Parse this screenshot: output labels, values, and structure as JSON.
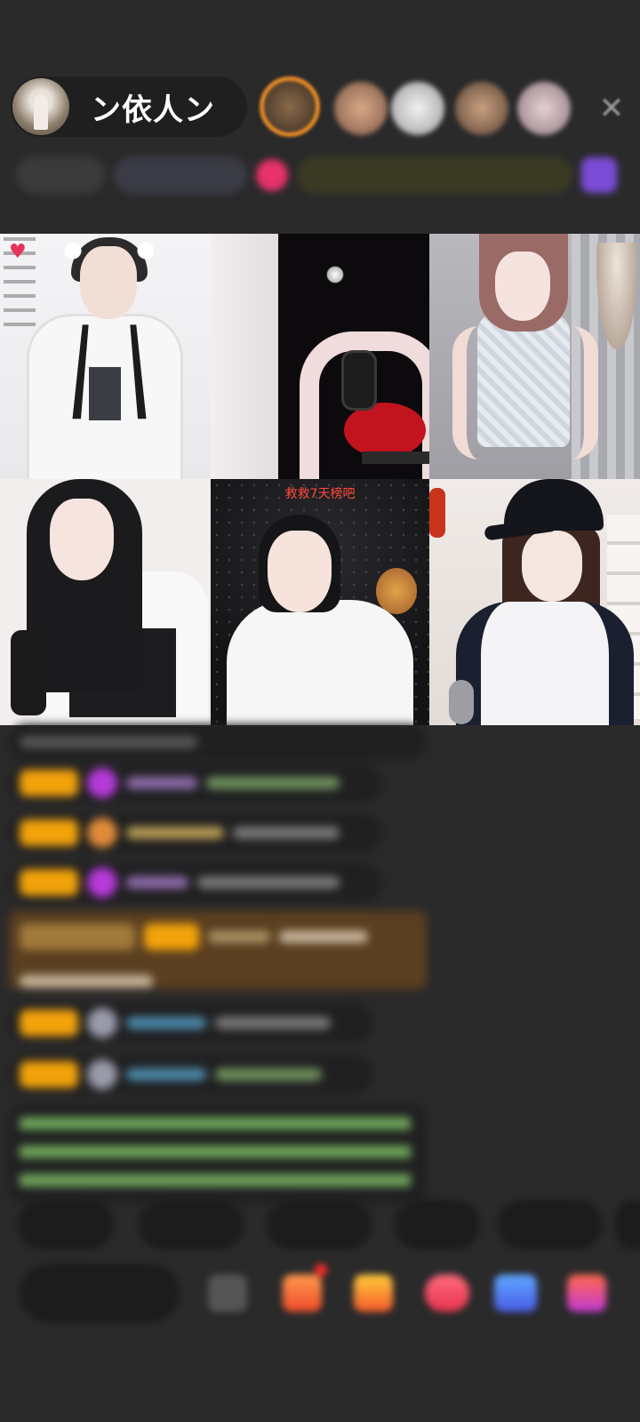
{
  "header": {
    "host_name": "ン依人ン",
    "close_icon": "close-icon"
  },
  "stream": {
    "overlay_caption": "救救7天榜吧"
  },
  "colors": {
    "background": "#2a2a2b",
    "badge": "#f2a20b",
    "accent_orange": "#e58a25",
    "caption_red": "#ff4a3a"
  }
}
